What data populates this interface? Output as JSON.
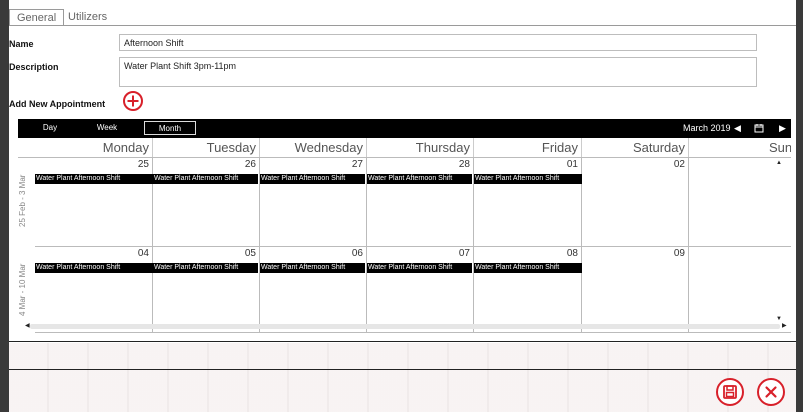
{
  "tabs": [
    {
      "label": "General",
      "active": true
    },
    {
      "label": "Utilizers",
      "active": false
    }
  ],
  "form": {
    "name_label": "Name",
    "name_value": "Afternoon Shift",
    "desc_label": "Description",
    "desc_value": "Water Plant Shift 3pm-11pm",
    "add_label": "Add New Appointment"
  },
  "calendar": {
    "views": [
      {
        "label": "Day"
      },
      {
        "label": "Week"
      },
      {
        "label": "Month",
        "active": true
      }
    ],
    "period": "March 2019",
    "days": [
      "Monday",
      "Tuesday",
      "Wednesday",
      "Thursday",
      "Friday",
      "Saturday",
      "Sunday"
    ],
    "weeks": [
      {
        "label": "25 Feb - 3 Mar",
        "dates": [
          "25",
          "26",
          "27",
          "28",
          "01",
          "02",
          ""
        ]
      },
      {
        "label": "4 Mar - 10 Mar",
        "dates": [
          "04",
          "05",
          "06",
          "07",
          "08",
          "09",
          ""
        ]
      }
    ],
    "appointment": "Water Plant Afternoon Shift"
  },
  "icons": {
    "add": "plus-circle-icon",
    "save": "save-icon",
    "close": "close-icon",
    "prev": "prev-icon",
    "next": "next-icon",
    "calendar": "calendar-icon"
  },
  "colors": {
    "accent": "#d8202a",
    "bar": "#000000"
  }
}
